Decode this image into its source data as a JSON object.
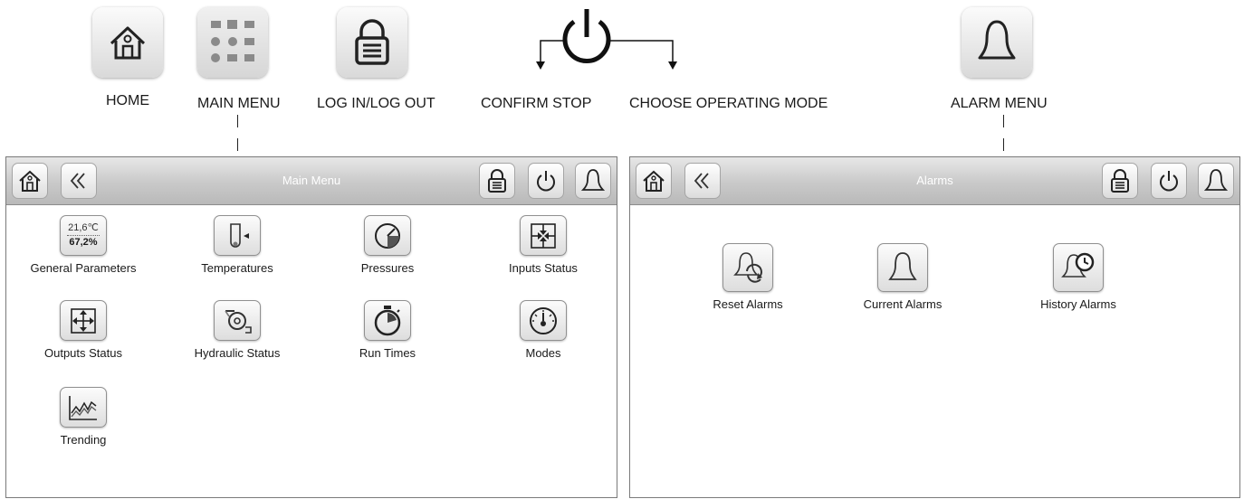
{
  "legend": {
    "home": "HOME",
    "main_menu": "MAIN MENU",
    "login_logout": "LOG IN/LOG OUT",
    "confirm_stop": "CONFIRM STOP",
    "choose_mode": "CHOOSE OPERATING MODE",
    "alarm_menu": "ALARM MENU"
  },
  "screen_main": {
    "title": "Main Menu",
    "general_values": {
      "temperature": "21,6℃",
      "humidity": "67,2%"
    },
    "items": [
      {
        "label": "General Parameters",
        "icon": "general-parameters-icon"
      },
      {
        "label": "Temperatures",
        "icon": "thermometer-icon"
      },
      {
        "label": "Pressures",
        "icon": "pressure-gauge-icon"
      },
      {
        "label": "Inputs Status",
        "icon": "inputs-arrows-icon"
      },
      {
        "label": "Outputs Status",
        "icon": "outputs-arrows-icon"
      },
      {
        "label": "Hydraulic Status",
        "icon": "pump-icon"
      },
      {
        "label": "Run Times",
        "icon": "stopwatch-icon"
      },
      {
        "label": "Modes",
        "icon": "dial-icon"
      },
      {
        "label": "Trending",
        "icon": "trend-chart-icon"
      }
    ]
  },
  "screen_alarms": {
    "title": "Alarms",
    "items": [
      {
        "label": "Reset Alarms",
        "icon": "bell-reset-icon"
      },
      {
        "label": "Current Alarms",
        "icon": "bell-icon"
      },
      {
        "label": "History Alarms",
        "icon": "bell-clock-icon"
      }
    ]
  }
}
